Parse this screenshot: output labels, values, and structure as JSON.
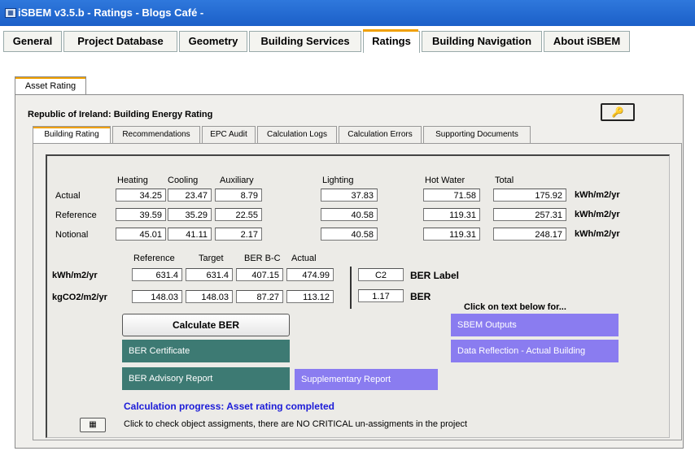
{
  "window": {
    "title": "iSBEM v3.5.b - Ratings - Blogs Café -",
    "icon": "app-icon"
  },
  "main_tabs": [
    {
      "label": "General"
    },
    {
      "label": "Project Database"
    },
    {
      "label": "Geometry"
    },
    {
      "label": "Building Services"
    },
    {
      "label": "Ratings",
      "selected": true
    },
    {
      "label": "Building Navigation"
    },
    {
      "label": "About iSBEM"
    }
  ],
  "sub_tab": {
    "label": "Asset Rating"
  },
  "panel_title": "Republic of Ireland: Building Energy Rating",
  "key_button": {
    "icon": "key-icon",
    "glyph": "🔑"
  },
  "inner_tabs": [
    {
      "label": "Building Rating",
      "selected": true
    },
    {
      "label": "Recommendations"
    },
    {
      "label": "EPC Audit"
    },
    {
      "label": "Calculation Logs"
    },
    {
      "label": "Calculation Errors"
    },
    {
      "label": "Supporting Documents"
    }
  ],
  "energy_table": {
    "columns": [
      "Heating",
      "Cooling",
      "Auxiliary",
      "Lighting",
      "Hot Water",
      "Total"
    ],
    "rows": [
      {
        "label": "Actual",
        "values": [
          "34.25",
          "23.47",
          "8.79",
          "37.83",
          "71.58",
          "175.92"
        ],
        "unit": "kWh/m2/yr"
      },
      {
        "label": "Reference",
        "values": [
          "39.59",
          "35.29",
          "22.55",
          "40.58",
          "119.31",
          "257.31"
        ],
        "unit": "kWh/m2/yr"
      },
      {
        "label": "Notional",
        "values": [
          "45.01",
          "41.11",
          "2.17",
          "40.58",
          "119.31",
          "248.17"
        ],
        "unit": "kWh/m2/yr"
      }
    ]
  },
  "ber_table": {
    "columns": [
      "Reference",
      "Target",
      "BER B-C",
      "Actual"
    ],
    "rows": [
      {
        "label": "kWh/m2/yr",
        "values": [
          "631.4",
          "631.4",
          "407.15",
          "474.99"
        ]
      },
      {
        "label": "kgCO2/m2/yr",
        "values": [
          "148.03",
          "148.03",
          "87.27",
          "113.12"
        ]
      }
    ]
  },
  "ber_label": {
    "value": "C2",
    "caption": "BER Label"
  },
  "ber_value": {
    "value": "1.17",
    "caption": "BER"
  },
  "click_hint": "Click on text below for...",
  "buttons": {
    "calculate": "Calculate  BER",
    "ber_certificate": "BER Certificate",
    "ber_advisory": "BER Advisory Report",
    "supplementary": "Supplementary Report",
    "sbem_outputs": "SBEM Outputs",
    "data_reflection": "Data Reflection - Actual Building"
  },
  "colors": {
    "teal": "#3d7a73",
    "purple": "#8a7cf0",
    "progress": "#1b1bd8"
  },
  "progress": "Calculation progress: Asset rating completed",
  "check_button": {
    "icon": "grid-icon"
  },
  "check_note": "Click to check object assigments, there are NO CRITICAL un-assigments in the project"
}
